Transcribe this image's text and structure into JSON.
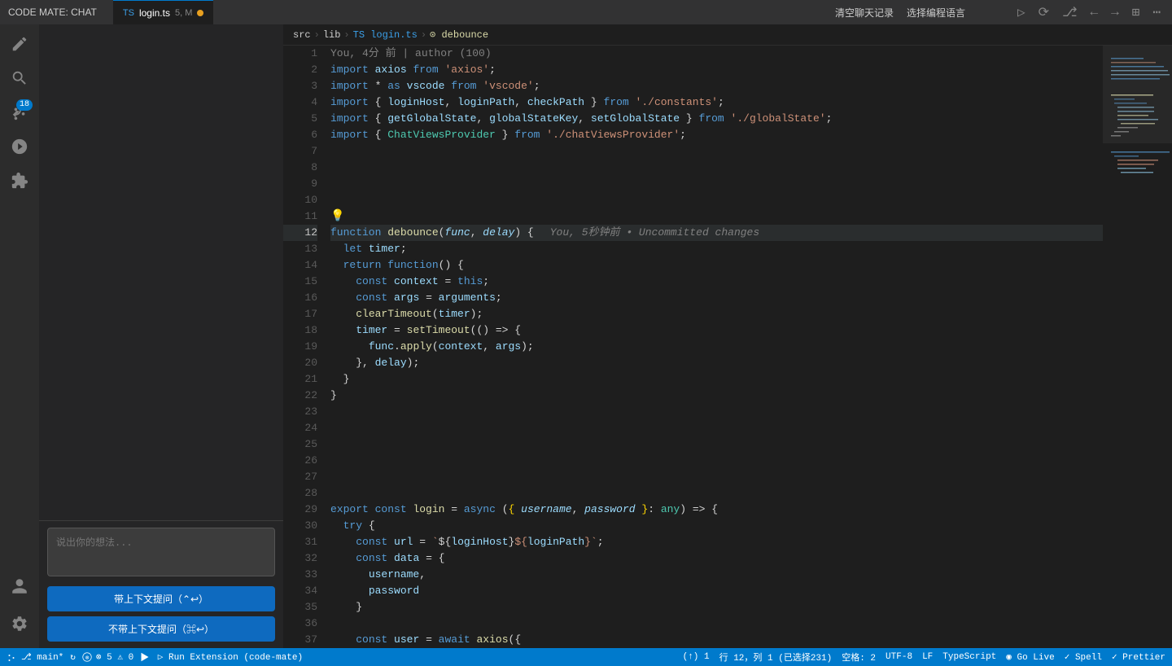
{
  "titlebar": {
    "title": "CODE MATE: CHAT",
    "actions": [
      "清空聊天记录",
      "选择编程语言"
    ],
    "tab": {
      "lang": "TS",
      "filename": "login.ts",
      "badge": "5, M",
      "modified": true
    }
  },
  "breadcrumb": {
    "parts": [
      "src",
      "lib",
      "login.ts",
      "debounce"
    ]
  },
  "activity": {
    "icons": [
      {
        "name": "explorer",
        "badge": null
      },
      {
        "name": "search",
        "badge": null
      },
      {
        "name": "source-control",
        "badge": "18"
      },
      {
        "name": "run",
        "badge": null
      },
      {
        "name": "extensions",
        "badge": null
      }
    ],
    "bottom": [
      {
        "name": "account"
      },
      {
        "name": "settings"
      }
    ]
  },
  "chat": {
    "input_placeholder": "说出你的想法...",
    "btn_with_context": "带上下文提问（⌃↩）",
    "btn_without_context": "不带上下文提问（⌘↩）"
  },
  "code": {
    "lines": [
      {
        "num": 1,
        "content": ""
      },
      {
        "num": 2,
        "content": "import axios from 'axios';"
      },
      {
        "num": 3,
        "content": "import * as vscode from 'vscode';"
      },
      {
        "num": 4,
        "content": "import { loginHost, loginPath, checkPath } from './constants';"
      },
      {
        "num": 5,
        "content": "import { getGlobalState, globalStateKey, setGlobalState } from './globalState';"
      },
      {
        "num": 6,
        "content": "import { ChatViewsProvider } from './chatViewsProvider';"
      },
      {
        "num": 7,
        "content": ""
      },
      {
        "num": 8,
        "content": ""
      },
      {
        "num": 9,
        "content": ""
      },
      {
        "num": 10,
        "content": ""
      },
      {
        "num": 11,
        "content": ""
      },
      {
        "num": 12,
        "content": "function debounce(func, delay) {"
      },
      {
        "num": 13,
        "content": "  let timer;"
      },
      {
        "num": 14,
        "content": "  return function() {"
      },
      {
        "num": 15,
        "content": "    const context = this;"
      },
      {
        "num": 16,
        "content": "    const args = arguments;"
      },
      {
        "num": 17,
        "content": "    clearTimeout(timer);"
      },
      {
        "num": 18,
        "content": "    timer = setTimeout(() => {"
      },
      {
        "num": 19,
        "content": "      func.apply(context, args);"
      },
      {
        "num": 20,
        "content": "    }, delay);"
      },
      {
        "num": 21,
        "content": "  }"
      },
      {
        "num": 22,
        "content": "}"
      },
      {
        "num": 23,
        "content": ""
      },
      {
        "num": 24,
        "content": ""
      },
      {
        "num": 25,
        "content": ""
      },
      {
        "num": 26,
        "content": ""
      },
      {
        "num": 27,
        "content": ""
      },
      {
        "num": 28,
        "content": ""
      },
      {
        "num": 29,
        "content": "export const login = async ({ username, password }: any) => {"
      },
      {
        "num": 30,
        "content": "  try {"
      },
      {
        "num": 31,
        "content": "    const url = `${loginHost}${loginPath}`;"
      },
      {
        "num": 32,
        "content": "    const data = {"
      },
      {
        "num": 33,
        "content": "      username,"
      },
      {
        "num": 34,
        "content": "      password"
      },
      {
        "num": 35,
        "content": "    }"
      },
      {
        "num": 36,
        "content": ""
      },
      {
        "num": 37,
        "content": "    const user = await axios({"
      }
    ]
  },
  "git_annotation": {
    "text": "You, 5秒钟前 • Uncommitted changes"
  },
  "status": {
    "branch": "⎇ main*",
    "sync": "↻",
    "errors": "⊗ 5  ⚠ 0",
    "run": "▷ Run Extension (code-mate)",
    "position": "(↑) 1",
    "line_col": "行 12，列 1 (已选择231)",
    "spaces": "空格: 2",
    "encoding": "UTF-8",
    "eol": "LF",
    "lang": "TypeScript",
    "go_live": "◉ Go Live",
    "spell": "✓ Spell",
    "prettier": "✓ Prettier"
  }
}
